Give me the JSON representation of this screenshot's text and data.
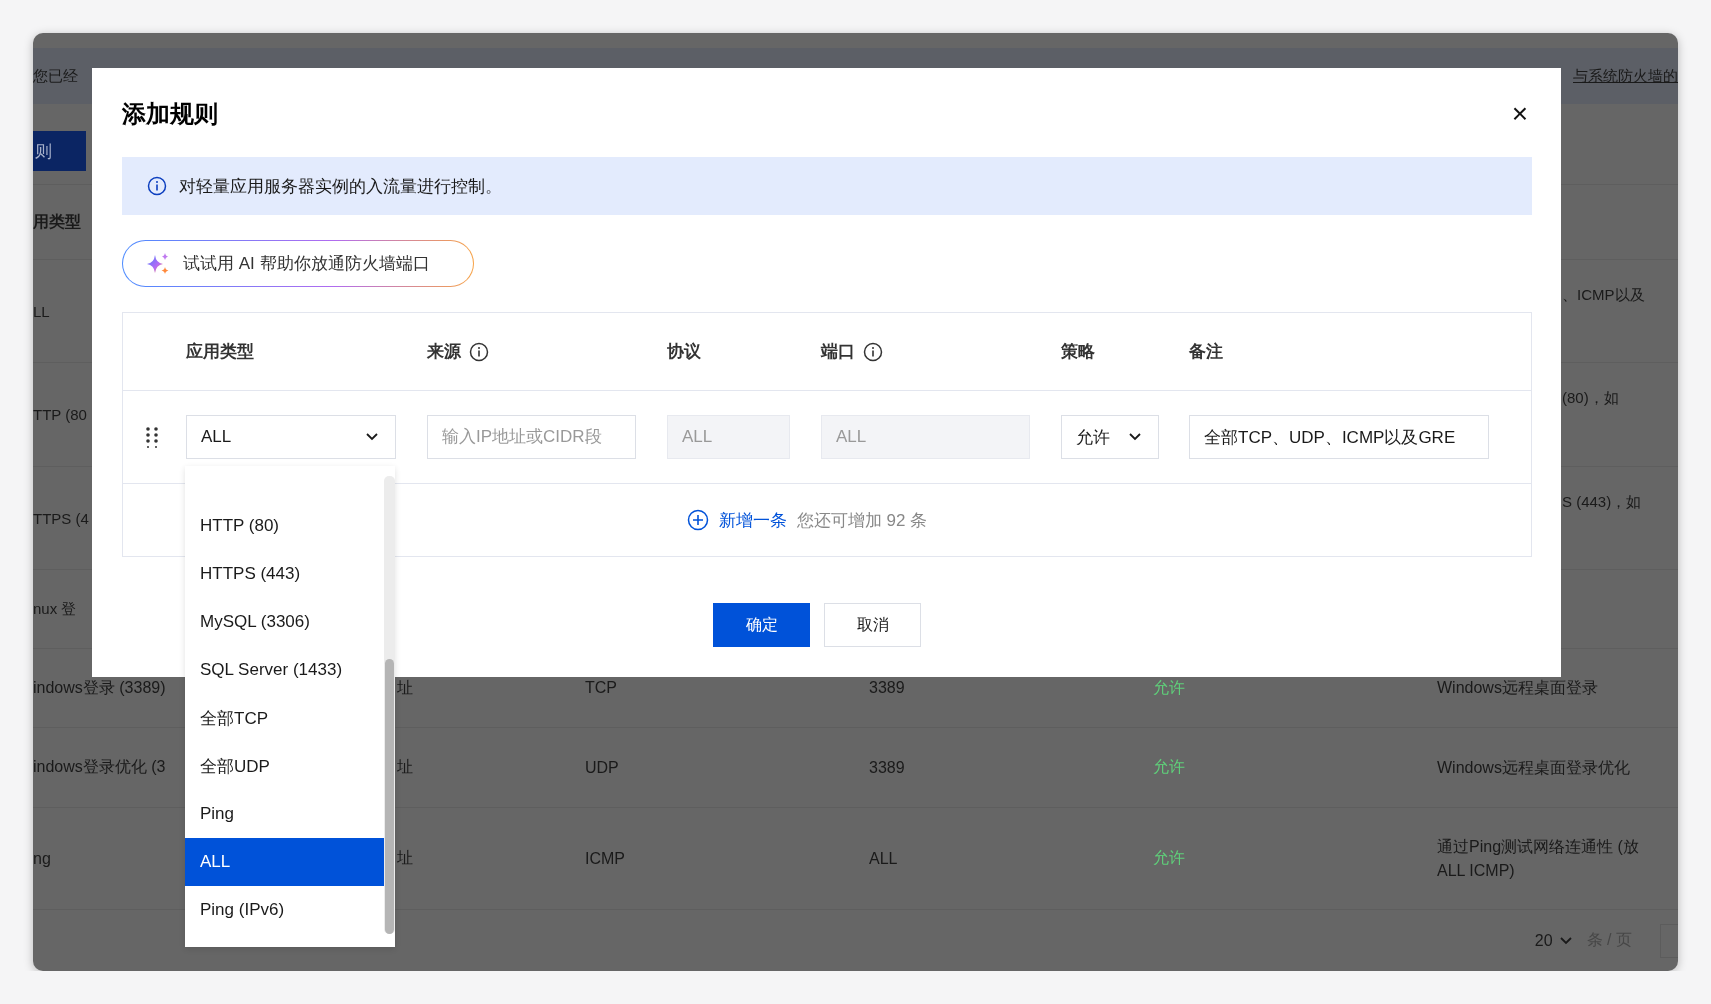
{
  "background_page": {
    "notice": {
      "start": "您已经",
      "end": "与系统防火墙的"
    },
    "add_button": "则",
    "header": "用类型",
    "partial_rows": [
      {
        "name": "LL",
        "remark": "、ICMP以及"
      },
      {
        "name": "TTP (80",
        "remark": "(80)，如"
      },
      {
        "name": "TTPS (4",
        "remark": "S (443)，如"
      },
      {
        "name": "nux 登"
      }
    ],
    "rows": [
      {
        "name": "indows登录 (3389)",
        "source": "址",
        "protocol": "TCP",
        "port": "3389",
        "policy": "允许",
        "remark": [
          "Windows远程桌面登录"
        ]
      },
      {
        "name": "indows登录优化 (3",
        "source": "址",
        "protocol": "UDP",
        "port": "3389",
        "policy": "允许",
        "remark": [
          "Windows远程桌面登录优化"
        ]
      },
      {
        "name": "ng",
        "source": "址",
        "protocol": "ICMP",
        "port": "ALL",
        "policy": "允许",
        "remark": [
          "通过Ping测试网络连通性 (放",
          "ALL ICMP)"
        ]
      }
    ],
    "pagination": {
      "page_size": "20",
      "unit": "条 / 页"
    }
  },
  "dialog": {
    "title": "添加规则",
    "close": "×",
    "info": "对轻量应用服务器实例的入流量进行控制。",
    "ai_button": "试试用 AI 帮助你放通防火墙端口",
    "columns": [
      {
        "label": "应用类型",
        "info": false
      },
      {
        "label": "来源",
        "info": true
      },
      {
        "label": "协议",
        "info": false
      },
      {
        "label": "端口",
        "info": true
      },
      {
        "label": "策略",
        "info": false
      },
      {
        "label": "备注",
        "info": false
      }
    ],
    "fields": [
      {
        "kind": "select",
        "value": "ALL",
        "disabled": false
      },
      {
        "kind": "input",
        "placeholder": "输入IP地址或CIDR段",
        "disabled": false
      },
      {
        "kind": "input",
        "placeholder": "ALL",
        "disabled": true
      },
      {
        "kind": "input",
        "placeholder": "ALL",
        "disabled": true
      },
      {
        "kind": "select",
        "value": "允许",
        "disabled": false
      },
      {
        "kind": "input",
        "value": "全部TCP、UDP、ICMP以及GRE",
        "disabled": false
      }
    ],
    "add_row": {
      "link": "新增一条",
      "hint": "您还可增加 92 条"
    },
    "buttons": [
      {
        "label": "确定",
        "kind": "primary"
      },
      {
        "label": "取消",
        "kind": "secondary"
      }
    ],
    "dropdown": [
      {
        "label": "HTTP (80)",
        "selected": false
      },
      {
        "label": "HTTPS (443)",
        "selected": false
      },
      {
        "label": "MySQL (3306)",
        "selected": false
      },
      {
        "label": "SQL Server (1433)",
        "selected": false
      },
      {
        "label": "全部TCP",
        "selected": false
      },
      {
        "label": "全部UDP",
        "selected": false
      },
      {
        "label": "Ping",
        "selected": false
      },
      {
        "label": "ALL",
        "selected": true
      },
      {
        "label": "Ping (IPv6)",
        "selected": false
      }
    ]
  }
}
